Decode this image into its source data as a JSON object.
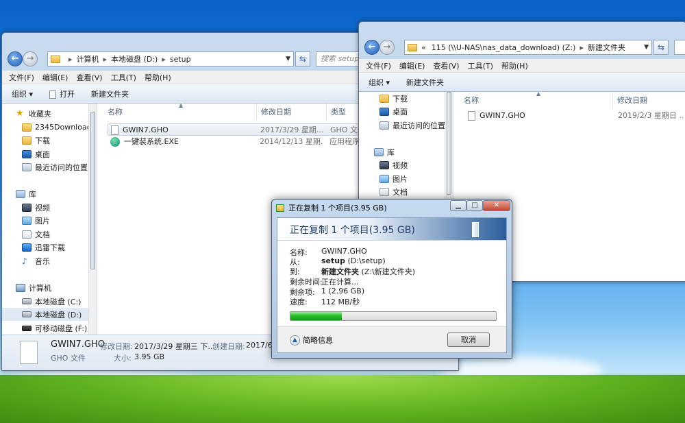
{
  "left_window": {
    "address": [
      "计算机",
      "本地磁盘 (D:)",
      "setup"
    ],
    "search_placeholder": "搜索 setup",
    "menu": [
      "文件(F)",
      "编辑(E)",
      "查看(V)",
      "工具(T)",
      "帮助(H)"
    ],
    "toolbar": {
      "organize": "组织 ▾",
      "open": "打开",
      "new_folder": "新建文件夹"
    },
    "nav": {
      "favorites": "收藏夹",
      "fav_items": [
        "2345Downloads",
        "下载",
        "桌面",
        "最近访问的位置"
      ],
      "libraries": "库",
      "lib_items": [
        "视频",
        "图片",
        "文档",
        "迅雷下载",
        "音乐"
      ],
      "computer": "计算机",
      "drives": [
        "本地磁盘 (C:)",
        "本地磁盘 (D:)",
        "可移动磁盘 (F:)"
      ]
    },
    "columns": [
      "名称",
      "修改日期",
      "类型"
    ],
    "files": [
      {
        "name": "GWIN7.GHO",
        "date": "2017/3/29 星期...",
        "type": "GHO 文件"
      },
      {
        "name": "一键装系统.EXE",
        "date": "2014/12/13 星期...",
        "type": "应用程序"
      }
    ],
    "details": {
      "name": "GWIN7.GHO",
      "modified_label": "修改日期:",
      "modified": "2017/3/29 星期三 下...",
      "created_label": "创建日期:",
      "created": "2017/6/...",
      "type": "GHO 文件",
      "size_label": "大小:",
      "size": "3.95 GB"
    }
  },
  "right_window": {
    "address_prefix": "«",
    "address": [
      "115 (\\\\U-NAS\\nas_data_download) (Z:)",
      "新建文件夹"
    ],
    "menu": [
      "文件(F)",
      "编辑(E)",
      "查看(V)",
      "工具(T)",
      "帮助(H)"
    ],
    "toolbar": {
      "organize": "组织 ▾",
      "new_folder": "新建文件夹"
    },
    "nav": {
      "fav_items": [
        "下载",
        "桌面",
        "最近访问的位置"
      ],
      "libraries": "库",
      "lib_items": [
        "视频",
        "图片",
        "文档"
      ]
    },
    "columns": [
      "名称",
      "修改日期"
    ],
    "files": [
      {
        "name": "GWIN7.GHO",
        "date": "2019/2/3 星期日 ..."
      }
    ]
  },
  "copy_dialog": {
    "title": "正在复制 1 个项目(3.95 GB)",
    "heading": "正在复制 1 个项目(3.95 GB)",
    "rows": [
      {
        "key": "名称:",
        "value": "GWIN7.GHO",
        "bold": ""
      },
      {
        "key": "从:",
        "bold": "setup",
        "value": " (D:\\setup)"
      },
      {
        "key": "到:",
        "bold": "新建文件夹",
        "value": " (Z:\\新建文件夹)"
      },
      {
        "key": "剩余时间:",
        "value": "正在计算...",
        "bold": ""
      },
      {
        "key": "剩余项:",
        "value": "1 (2.96 GB)",
        "bold": ""
      },
      {
        "key": "速度:",
        "value": "112 MB/秒",
        "bold": ""
      }
    ],
    "progress_fraction": 0.25,
    "more_info": "简略信息",
    "cancel": "取消"
  }
}
